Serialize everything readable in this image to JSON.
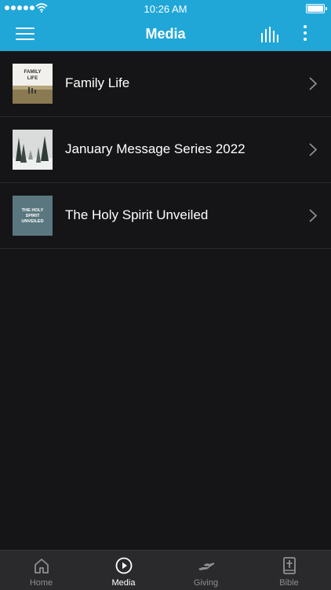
{
  "status_bar": {
    "time": "10:26 AM"
  },
  "nav": {
    "title": "Media"
  },
  "media_items": [
    {
      "title": "Family Life",
      "thumb_text": "FAMILY LIFE"
    },
    {
      "title": "January Message Series 2022",
      "thumb_text": ""
    },
    {
      "title": "The Holy Spirit Unveiled",
      "thumb_text": "THE HOLY SPIRIT UNVEILED"
    }
  ],
  "tabs": [
    {
      "label": "Home",
      "icon": "home-icon"
    },
    {
      "label": "Media",
      "icon": "play-circle-icon"
    },
    {
      "label": "Giving",
      "icon": "giving-hand-icon"
    },
    {
      "label": "Bible",
      "icon": "bible-icon"
    }
  ],
  "colors": {
    "accent": "#20a7d8",
    "background": "#151517",
    "tabbar": "#2a2a2c"
  }
}
